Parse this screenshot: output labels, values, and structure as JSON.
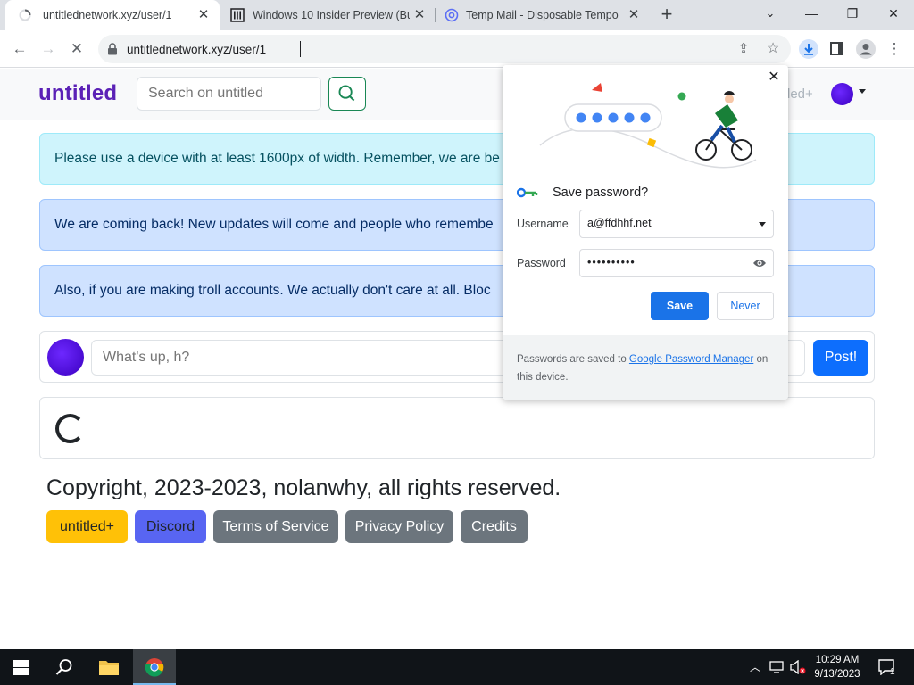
{
  "browser": {
    "tabs": [
      {
        "title": "untitlednetwork.xyz/user/1",
        "active": true,
        "favicon": "loading-spinner-icon"
      },
      {
        "title": "Windows 10 Insider Preview (Buil",
        "active": false,
        "favicon": "building-columns-icon"
      },
      {
        "title": "Temp Mail - Disposable Tempora",
        "active": false,
        "favicon": "at-sign-icon"
      }
    ],
    "url": "untitlednetwork.xyz/user/1",
    "accent": "#1a73e8"
  },
  "site": {
    "brand": "untitled",
    "brand_color": "#5b21b6",
    "search_placeholder": "Search on untitled",
    "nav_partial": "led+",
    "alerts": [
      {
        "text": "Please use a device with at least 1600px of width. Remember, we are be",
        "style": "info"
      },
      {
        "text": "We are coming back! New updates will come and people who remembe",
        "style": "primary"
      },
      {
        "text": "Also, if you are making troll accounts. We actually don't care at all. Bloc",
        "style": "primary"
      }
    ],
    "post_placeholder": "What's up, h?",
    "post_button": "Post!",
    "copyright": "Copyright, 2023-2023, nolanwhy, all rights reserved.",
    "footer_buttons": [
      {
        "label": "untitled+",
        "color": "#ffc107",
        "text_color": "#212529"
      },
      {
        "label": "Discord",
        "color": "#5865f2",
        "text_color": "#212529"
      },
      {
        "label": "Terms of Service",
        "color": "#6c757d",
        "text_color": "#ffffff"
      },
      {
        "label": "Privacy Policy",
        "color": "#6c757d",
        "text_color": "#ffffff"
      },
      {
        "label": "Credits",
        "color": "#6c757d",
        "text_color": "#ffffff"
      }
    ]
  },
  "password_popup": {
    "title": "Save password?",
    "username_label": "Username",
    "username_value": "a@ffdhhf.net",
    "password_label": "Password",
    "password_value": "••••••••••",
    "save_label": "Save",
    "never_label": "Never",
    "footer_prefix": "Passwords are saved to ",
    "footer_link": "Google Password Manager",
    "footer_suffix": " on this device."
  },
  "taskbar": {
    "time": "10:29 AM",
    "date": "9/13/2023",
    "notification_count": "1"
  }
}
